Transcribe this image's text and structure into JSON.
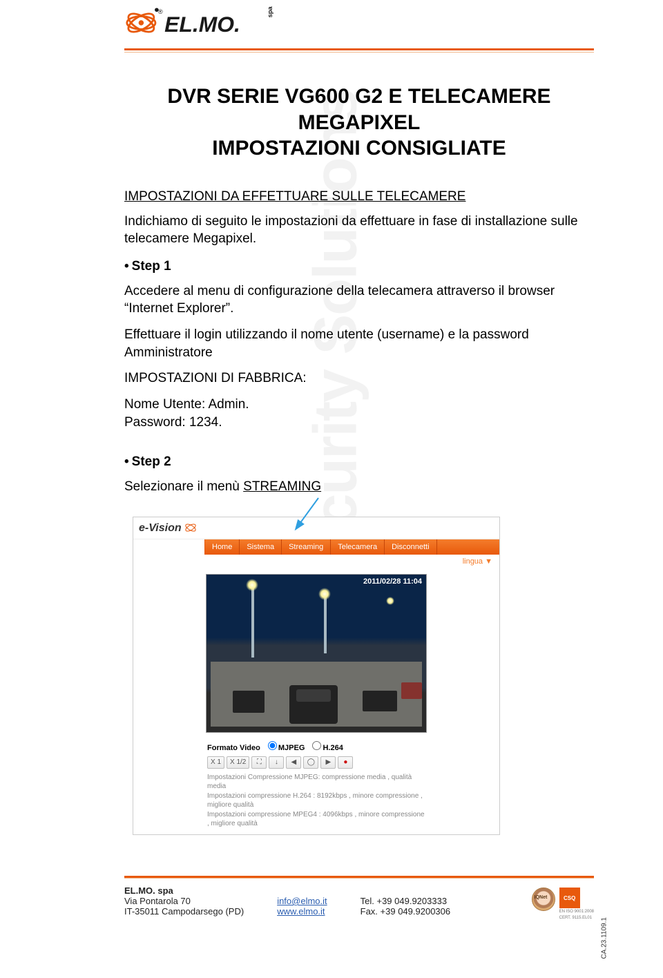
{
  "watermark": "Global Security Solutions",
  "title_l1": "DVR SERIE VG600 G2 E TELECAMERE MEGAPIXEL",
  "title_l2": "IMPOSTAZIONI CONSIGLIATE",
  "section1": "IMPOSTAZIONI DA EFFETTUARE SULLE TELECAMERE",
  "intro": "Indichiamo di seguito le impostazioni da effettuare in fase di installazione sulle telecamere Megapixel.",
  "step1": "Step 1",
  "s1p1": "Accedere al menu di configurazione della telecamera attraverso il browser “Internet Explorer”.",
  "s1p2": "Effettuare il login utilizzando il nome utente (username) e la password Amministratore",
  "s1p3": "IMPOSTAZIONI DI FABBRICA:",
  "s1p4": "Nome Utente: Admin.",
  "s1p5": "Password: 1234.",
  "step2": "Step 2",
  "s2p1_a": "Selezionare il menù ",
  "s2p1_b": "STREAMING",
  "ui": {
    "brand": "e-Vision",
    "menu": [
      "Home",
      "Sistema",
      "Streaming",
      "Telecamera",
      "Disconnetti"
    ],
    "lang": "lingua ▼",
    "timestamp": "2011/02/28 11:04",
    "fmt_label": "Formato Video",
    "fmt_a": "MJPEG",
    "fmt_b": "H.264",
    "btns": [
      "X 1",
      "X 1/2",
      "⛶",
      "↓",
      "◀",
      "◯",
      "▶",
      "●"
    ],
    "line1": "Impostazioni Compressione MJPEG: compressione media , qualità media",
    "line2": "Impostazioni compressione H.264  : 8192kbps , minore compressione , migliore qualità",
    "line3": "Impostazioni compressione MPEG4 : 4096kbps , minore compressione , migliore qualità"
  },
  "footer": {
    "company": "EL.MO. spa",
    "addr1": "Via Pontarola 70",
    "addr2": "IT-35011 Campodarsego (PD)",
    "email": "info@elmo.it",
    "web": "www.elmo.it",
    "tel": "Tel. +39 049.9203333",
    "fax": "Fax. +39 049.9200306"
  },
  "cert": {
    "sq": "CSQ",
    "iso1": "EN ISO 9001:2008",
    "iso2": "CERT. 9115.EL01"
  },
  "sidecode": "CA.23.1109.1"
}
